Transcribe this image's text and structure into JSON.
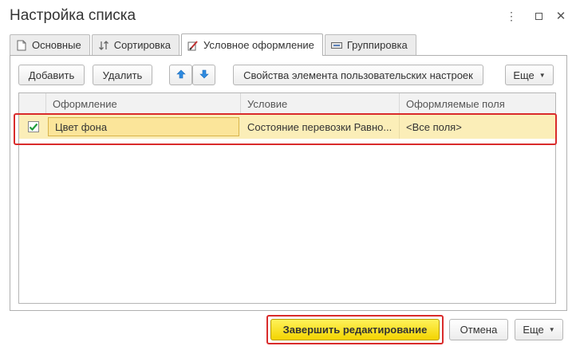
{
  "window": {
    "title": "Настройка списка",
    "more_symbol": "⋮",
    "close_symbol": "✕"
  },
  "tabs": [
    {
      "label": "Основные",
      "icon": "document-icon",
      "active": false
    },
    {
      "label": "Сортировка",
      "icon": "sort-icon",
      "active": false
    },
    {
      "label": "Условное оформление",
      "icon": "brush-icon",
      "active": true
    },
    {
      "label": "Группировка",
      "icon": "grouping-icon",
      "active": false
    }
  ],
  "toolbar": {
    "add_label": "Добавить",
    "delete_label": "Удалить",
    "properties_label": "Свойства элемента пользовательских настроек",
    "more_label": "Еще"
  },
  "table": {
    "columns": [
      "Оформление",
      "Условие",
      "Оформляемые поля"
    ],
    "rows": [
      {
        "checked": true,
        "appearance": "Цвет фона",
        "condition": "Состояние перевозки Равно...",
        "fields": "<Все поля>"
      }
    ]
  },
  "footer": {
    "finish_label": "Завершить редактирование",
    "cancel_label": "Отмена",
    "more_label": "Еще"
  },
  "colors": {
    "accent_yellow": "#f3d400",
    "row_highlight": "#fbeeb8",
    "annotation_red": "#d92b2b",
    "arrow_blue": "#2f8be0"
  }
}
